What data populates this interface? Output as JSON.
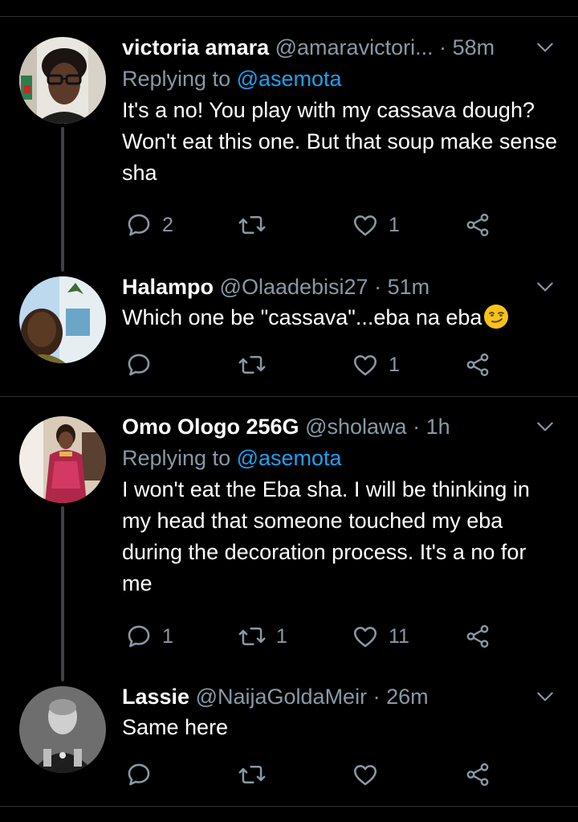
{
  "tweets": [
    {
      "name": "victoria amara",
      "handle": "@amaravictori...",
      "dot": "·",
      "time": "58m",
      "replying_prefix": "Replying to",
      "replying_to": "@asemota",
      "text": "It's a no! You play with my cassava dough? Won't eat this one. But that soup make sense sha",
      "reply_count": "2",
      "retweet_count": "",
      "like_count": "1"
    },
    {
      "name": "Halampo",
      "handle": "@Olaadebisi27",
      "dot": "·",
      "time": "51m",
      "text": "Which one be \"cassava\"...eba na eba",
      "emoji": "smirk-emoji",
      "reply_count": "",
      "retweet_count": "",
      "like_count": "1"
    },
    {
      "name": "Omo Ologo 256G",
      "handle": "@sholawa",
      "dot": "·",
      "time": "1h",
      "replying_prefix": "Replying to",
      "replying_to": "@asemota",
      "text": "I won't eat the Eba sha. I will be thinking in my head that someone touched my eba during the decoration process. It's a no for me",
      "reply_count": "1",
      "retweet_count": "1",
      "like_count": "11"
    },
    {
      "name": "Lassie",
      "handle": "@NaijaGoldaMeir",
      "dot": "·",
      "time": "26m",
      "text": "Same here",
      "reply_count": "",
      "retweet_count": "",
      "like_count": ""
    }
  ],
  "colors": {
    "background": "#000000",
    "secondary_text": "#8899a6",
    "mention": "#1da1f2",
    "divider": "#2f3336"
  },
  "icons": [
    "reply-icon",
    "retweet-icon",
    "like-icon",
    "share-icon",
    "chevron-down-icon"
  ]
}
